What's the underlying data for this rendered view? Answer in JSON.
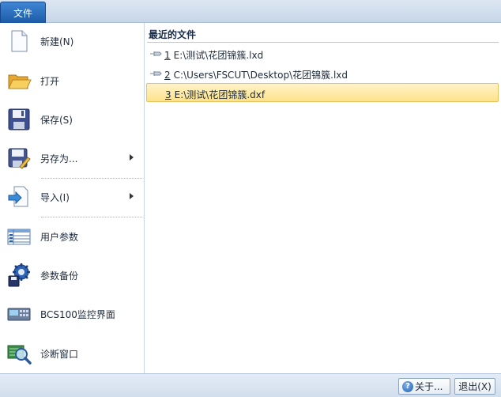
{
  "file_tab": "文件",
  "menu": {
    "new_label": "新建(N)",
    "open_label": "打开",
    "save_label": "保存(S)",
    "saveas_label": "另存为...",
    "import_label": "导入(I)",
    "user_params_label": "用户参数",
    "param_backup_label": "参数备份",
    "bcs_label": "BCS100监控界面",
    "diag_label": "诊断窗口"
  },
  "recent": {
    "title": "最近的文件",
    "items": [
      {
        "num": "1",
        "path": "E:\\测试\\花团锦簇.lxd"
      },
      {
        "num": "2",
        "path": "C:\\Users\\FSCUT\\Desktop\\花团锦簇.lxd"
      },
      {
        "num": "3",
        "path": "E:\\测试\\花团锦簇.dxf"
      }
    ]
  },
  "footer": {
    "about_label": "关于...",
    "exit_label": "退出(X)"
  },
  "icons": {
    "new": "new-document-icon",
    "open": "open-folder-icon",
    "save": "floppy-disk-icon",
    "saveas": "save-as-icon",
    "import": "import-icon",
    "user_params": "table-icon",
    "param_backup": "gear-backup-icon",
    "bcs": "monitor-panel-icon",
    "diag": "magnifier-icon",
    "pin": "pin-icon",
    "help": "help-icon"
  },
  "colors": {
    "accent": "#1c5aa6",
    "selection": "#fde28c"
  }
}
